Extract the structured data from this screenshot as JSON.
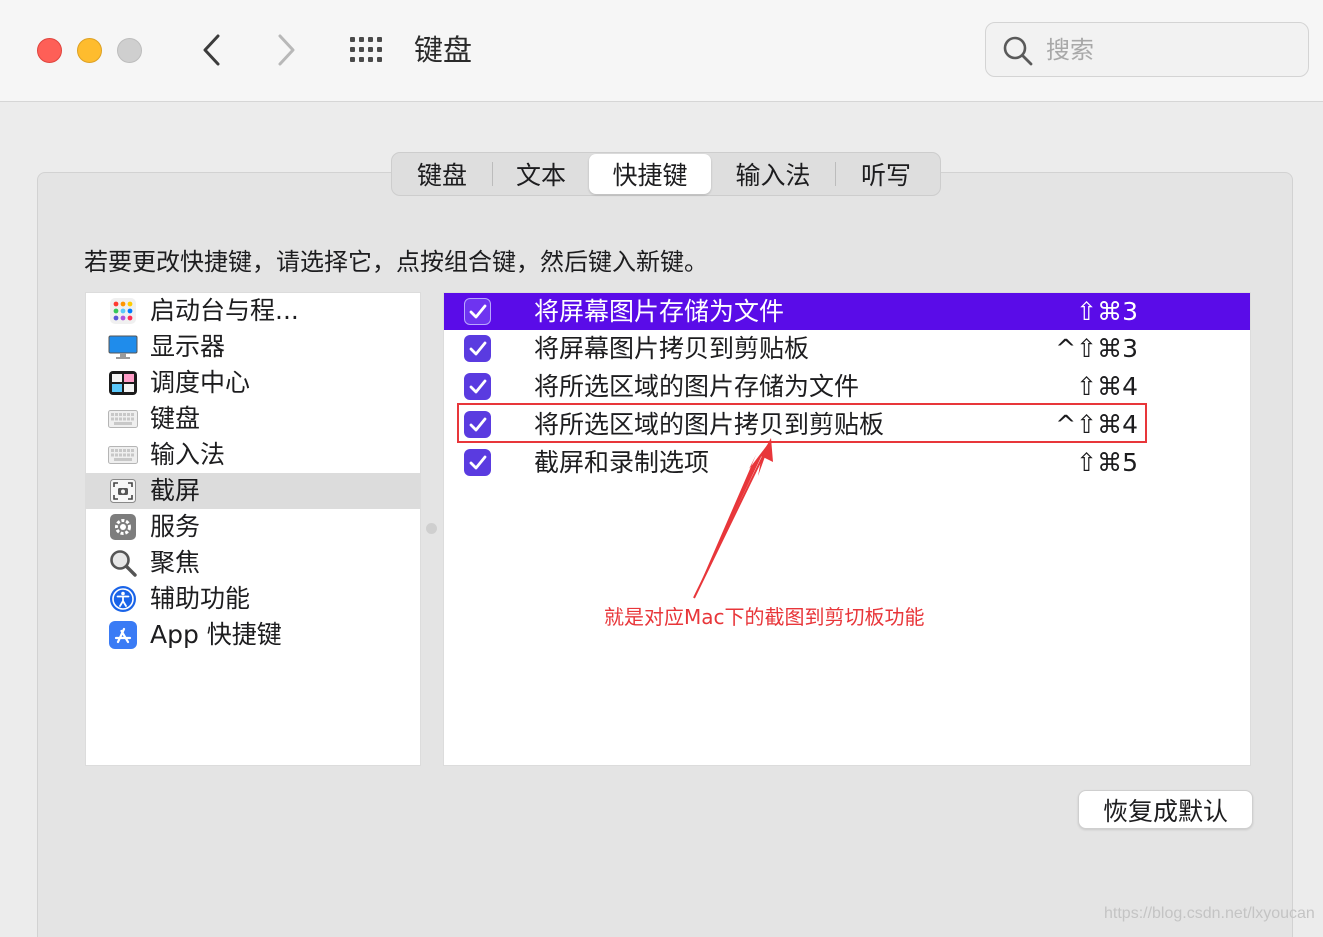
{
  "window": {
    "title": "键盘",
    "search_placeholder": "搜索"
  },
  "tabs": [
    {
      "label": "键盘",
      "active": false
    },
    {
      "label": "文本",
      "active": false
    },
    {
      "label": "快捷键",
      "active": true
    },
    {
      "label": "输入法",
      "active": false
    },
    {
      "label": "听写",
      "active": false
    }
  ],
  "instruction": "若要更改快捷键，请选择它，点按组合键，然后键入新键。",
  "categories": [
    {
      "label": "启动台与程...",
      "icon": "launchpad-icon",
      "selected": false
    },
    {
      "label": "显示器",
      "icon": "display-icon",
      "selected": false
    },
    {
      "label": "调度中心",
      "icon": "mission-control-icon",
      "selected": false
    },
    {
      "label": "键盘",
      "icon": "keyboard-icon",
      "selected": false
    },
    {
      "label": "输入法",
      "icon": "input-source-icon",
      "selected": false
    },
    {
      "label": "截屏",
      "icon": "screenshot-icon",
      "selected": true
    },
    {
      "label": "服务",
      "icon": "gear-icon",
      "selected": false
    },
    {
      "label": "聚焦",
      "icon": "spotlight-icon",
      "selected": false
    },
    {
      "label": "辅助功能",
      "icon": "accessibility-icon",
      "selected": false
    },
    {
      "label": "App 快捷键",
      "icon": "app-store-icon",
      "selected": false
    }
  ],
  "shortcuts": [
    {
      "label": "将屏幕图片存储为文件",
      "keys": "⇧⌘3",
      "checked": true,
      "selected": true
    },
    {
      "label": "将屏幕图片拷贝到剪贴板",
      "keys": "^⇧⌘3",
      "checked": true,
      "selected": false
    },
    {
      "label": "将所选区域的图片存储为文件",
      "keys": "⇧⌘4",
      "checked": true,
      "selected": false
    },
    {
      "label": "将所选区域的图片拷贝到剪贴板",
      "keys": "^⇧⌘4",
      "checked": true,
      "selected": false
    },
    {
      "label": "截屏和录制选项",
      "keys": "⇧⌘5",
      "checked": true,
      "selected": false
    }
  ],
  "annotation": {
    "text": "就是对应Mac下的截图到剪切板功能",
    "color": "#e8363a"
  },
  "restore_button": "恢复成默认",
  "watermark": "https://blog.csdn.net/lxyoucan",
  "colors": {
    "selection": "#5a0ce8",
    "checkbox": "#5a3be0"
  }
}
